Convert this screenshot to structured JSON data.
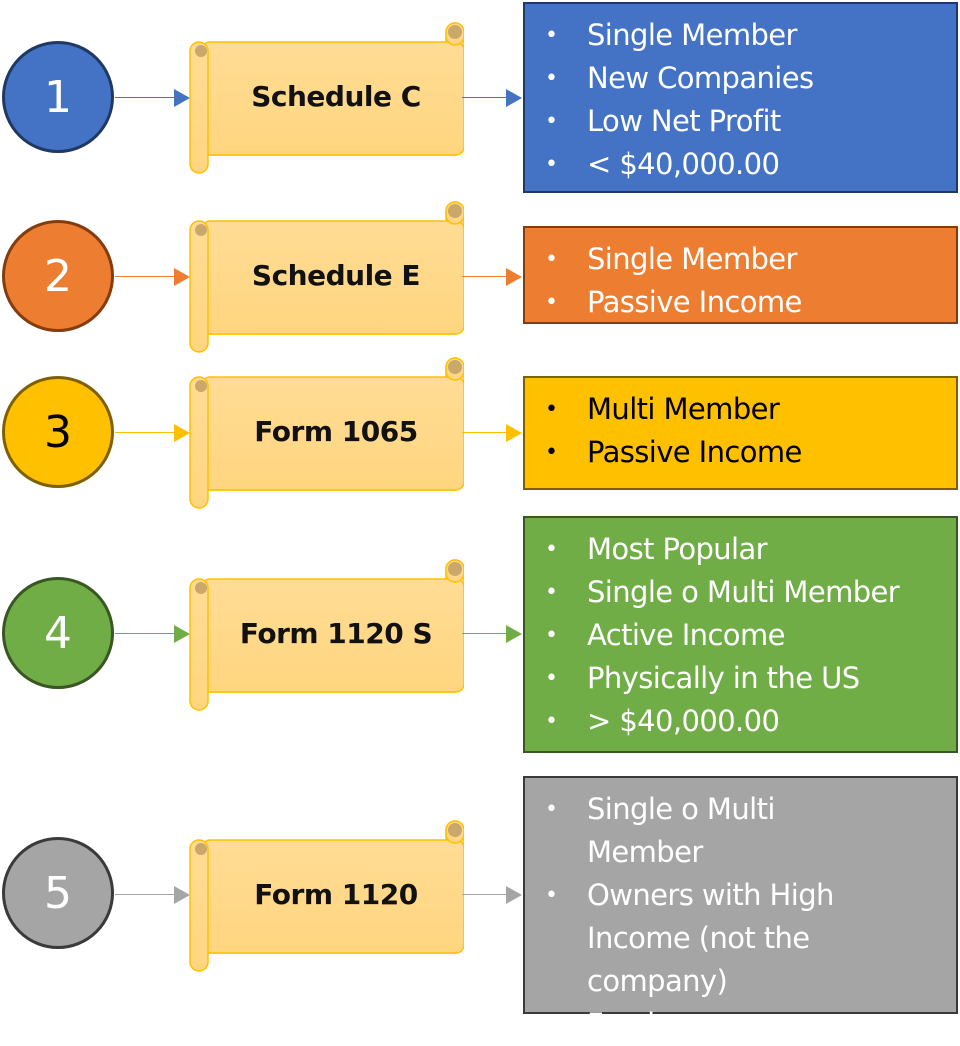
{
  "diagram_title": "",
  "rows": [
    {
      "number": "1",
      "form": "Schedule C",
      "color": "#4472C4",
      "circle_border": "#203864",
      "circle_text_color": "#ffffff",
      "box_border": "#203864",
      "text_color": "#ffffff",
      "bullets": [
        "Single Member",
        "New Companies",
        "Low Net Profit",
        "< $40,000.00"
      ]
    },
    {
      "number": "2",
      "form": "Schedule E",
      "color": "#ED7D31",
      "circle_border": "#843C0C",
      "circle_text_color": "#ffffff",
      "box_border": "#843C0C",
      "text_color": "#ffffff",
      "bullets": [
        "Single Member",
        "Passive Income"
      ]
    },
    {
      "number": "3",
      "form": "Form 1065",
      "color": "#FFC000",
      "circle_border": "#7F6000",
      "circle_text_color": "#000000",
      "box_border": "#7F6000",
      "text_color": "#000000",
      "bullets": [
        "Multi Member",
        "Passive Income"
      ]
    },
    {
      "number": "4",
      "form": "Form 1120 S",
      "color": "#70AD47",
      "circle_border": "#385723",
      "circle_text_color": "#ffffff",
      "box_border": "#385723",
      "text_color": "#ffffff",
      "bullets": [
        "Most Popular",
        "Single o Multi Member",
        "Active Income",
        "Physically in the US",
        "> $40,000.00"
      ]
    },
    {
      "number": "5",
      "form": "Form 1120",
      "color": "#A5A5A5",
      "circle_border": "#3A3A3A",
      "circle_text_color": "#ffffff",
      "box_border": "#3A3A3A",
      "text_color": "#ffffff",
      "bullets": [
        "Single o Multi Member",
        "Owners with High Income (not the company)",
        "Foreigners"
      ]
    }
  ],
  "scroll_colors": {
    "fill": "#FFD98E",
    "stroke": "#FFC000",
    "curl": "#C9A86A"
  },
  "icons": {
    "bullet": "•"
  }
}
